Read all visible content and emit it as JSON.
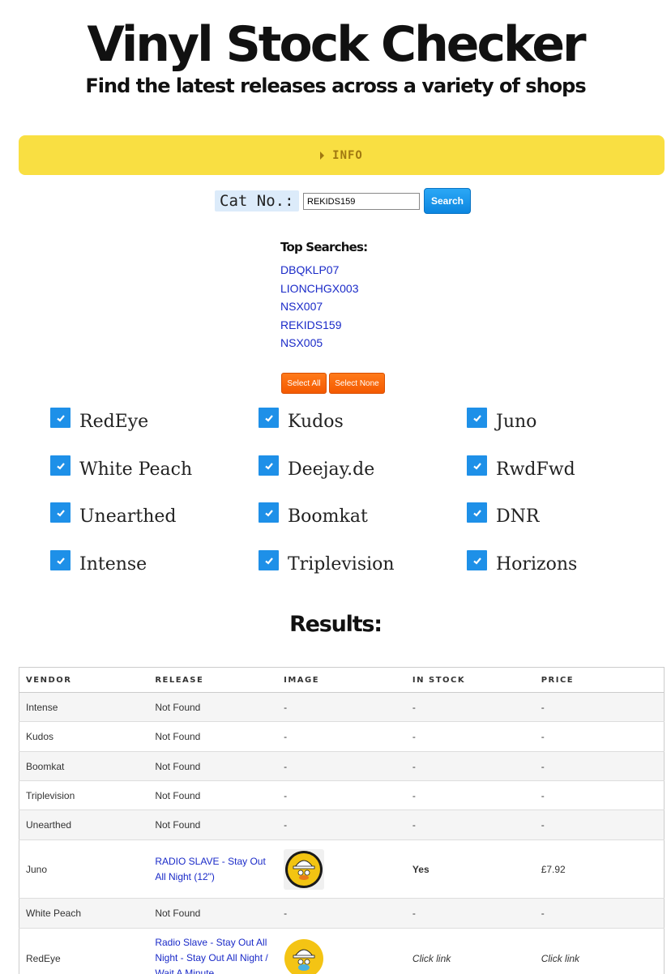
{
  "header": {
    "title": "Vinyl Stock Checker",
    "subtitle": "Find the latest releases across a variety of shops"
  },
  "info": {
    "label": "INFO"
  },
  "search": {
    "label": "Cat No.:",
    "value": "REKIDS159",
    "button": "Search"
  },
  "top_searches": {
    "heading": "Top Searches:",
    "items": [
      "DBQKLP07",
      "LIONCHGX003",
      "NSX007",
      "REKIDS159",
      "NSX005"
    ]
  },
  "select_buttons": {
    "all": "Select All",
    "none": "Select None"
  },
  "vendors": [
    {
      "name": "RedEye",
      "checked": true
    },
    {
      "name": "Kudos",
      "checked": true
    },
    {
      "name": "Juno",
      "checked": true
    },
    {
      "name": "White Peach",
      "checked": true
    },
    {
      "name": "Deejay.de",
      "checked": true
    },
    {
      "name": "RwdFwd",
      "checked": true
    },
    {
      "name": "Unearthed",
      "checked": true
    },
    {
      "name": "Boomkat",
      "checked": true
    },
    {
      "name": "DNR",
      "checked": true
    },
    {
      "name": "Intense",
      "checked": true
    },
    {
      "name": "Triplevision",
      "checked": true
    },
    {
      "name": "Horizons",
      "checked": true
    }
  ],
  "results": {
    "heading": "Results:",
    "columns": [
      "VENDOR",
      "RELEASE",
      "IMAGE",
      "IN STOCK",
      "PRICE"
    ],
    "rows": [
      {
        "vendor": "Intense",
        "release": "Not Found",
        "release_link": false,
        "image": "-",
        "in_stock": "-",
        "price": "-"
      },
      {
        "vendor": "Kudos",
        "release": "Not Found",
        "release_link": false,
        "image": "-",
        "in_stock": "-",
        "price": "-"
      },
      {
        "vendor": "Boomkat",
        "release": "Not Found",
        "release_link": false,
        "image": "-",
        "in_stock": "-",
        "price": "-"
      },
      {
        "vendor": "Triplevision",
        "release": "Not Found",
        "release_link": false,
        "image": "-",
        "in_stock": "-",
        "price": "-"
      },
      {
        "vendor": "Unearthed",
        "release": "Not Found",
        "release_link": false,
        "image": "-",
        "in_stock": "-",
        "price": "-"
      },
      {
        "vendor": "Juno",
        "release": "RADIO SLAVE - Stay Out All Night (12\")",
        "release_link": true,
        "image": "cover",
        "in_stock": "Yes",
        "price": "£7.92"
      },
      {
        "vendor": "White Peach",
        "release": "Not Found",
        "release_link": false,
        "image": "-",
        "in_stock": "-",
        "price": "-"
      },
      {
        "vendor": "RedEye",
        "release": "Radio Slave - Stay Out All Night - Stay Out All Night / Wait A Minute",
        "release_link": true,
        "image": "cover",
        "in_stock": "Click link",
        "price": "Click link"
      }
    ]
  },
  "colors": {
    "info_bar": "#f9df42",
    "search_button": "#1a93ea",
    "select_buttons": "#f86a0c",
    "checkbox": "#1e90e8",
    "link": "#1a2ac8"
  }
}
